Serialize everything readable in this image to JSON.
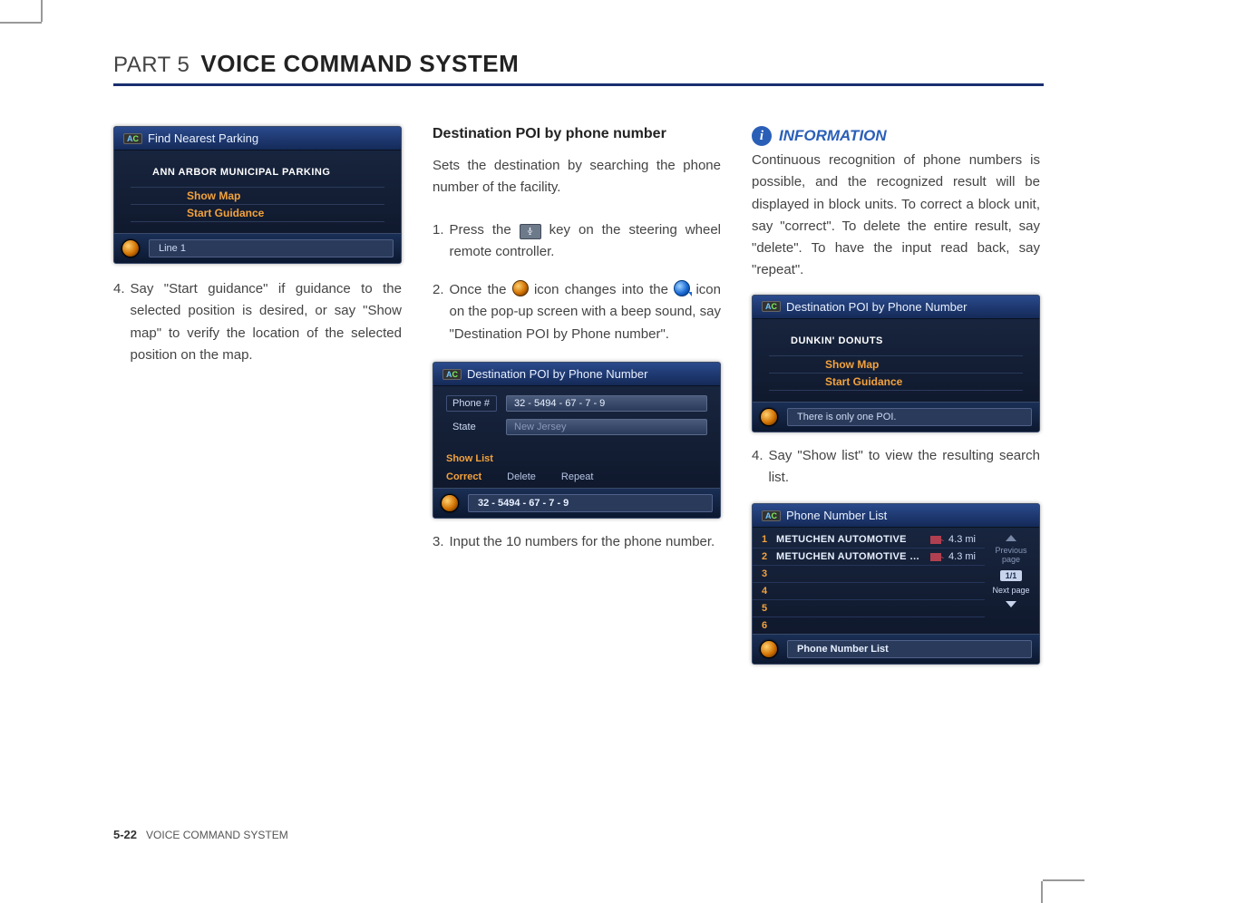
{
  "header": {
    "part": "PART 5",
    "title": "VOICE COMMAND SYSTEM"
  },
  "ac_badge": "AC",
  "panel1": {
    "title": "Find Nearest Parking",
    "result": "ANN ARBOR MUNICIPAL PARKING",
    "link_show_map": "Show Map",
    "link_start_guidance": "Start Guidance",
    "status": "Line 1"
  },
  "col1": {
    "step4": "Say \"Start guidance\" if guidance to the selected position is desired, or say \"Show map\" to verify the location of the selected position on the map."
  },
  "col2": {
    "subheading": "Destination POI by phone number",
    "intro": "Sets the destination by searching the phone number of the facility.",
    "step1a": "Press the ",
    "step1b": " key on the steering wheel remote controller.",
    "step2a": "Once the ",
    "step2b": " icon changes into the ",
    "step2c": " icon on the pop-up screen with a beep sound, say \"Destination POI by Phone number\".",
    "step3": "Input the 10 numbers for the phone number."
  },
  "panel2": {
    "title": "Destination POI by Phone Number",
    "phone_label": "Phone #",
    "phone_value": "32 - 5494 - 67 - 7 - 9",
    "state_label": "State",
    "state_value": "New Jersey",
    "cmd_showlist": "Show List",
    "cmd_correct": "Correct",
    "cmd_delete": "Delete",
    "cmd_repeat": "Repeat",
    "status": "32 - 5494 - 67 - 7 - 9"
  },
  "col3": {
    "info_title": "INFORMATION",
    "info_body": "Continuous recognition of phone numbers is possible, and the recognized result will be displayed in block units. To correct a block unit, say \"correct\". To delete the entire result, say \"delete\". To have the input read back, say \"repeat\".",
    "step4": "Say \"Show list\" to view the resulting search list."
  },
  "panel3": {
    "title": "Destination POI by Phone Number",
    "result": "DUNKIN' DONUTS",
    "link_show_map": "Show Map",
    "link_start_guidance": "Start Guidance",
    "status": "There is only one POI."
  },
  "panel4": {
    "title": "Phone Number List",
    "rows": [
      {
        "n": "1",
        "name": "METUCHEN AUTOMOTIVE",
        "dist": "4.3 mi"
      },
      {
        "n": "2",
        "name": "METUCHEN AUTOMOTIVE S...",
        "dist": "4.3 mi"
      },
      {
        "n": "3",
        "name": "",
        "dist": ""
      },
      {
        "n": "4",
        "name": "",
        "dist": ""
      },
      {
        "n": "5",
        "name": "",
        "dist": ""
      },
      {
        "n": "6",
        "name": "",
        "dist": ""
      }
    ],
    "prev": "Previous page",
    "page_ind": "1/1",
    "next": "Next page",
    "status": "Phone Number List"
  },
  "footer": {
    "page": "5-22",
    "section": "VOICE COMMAND SYSTEM"
  }
}
